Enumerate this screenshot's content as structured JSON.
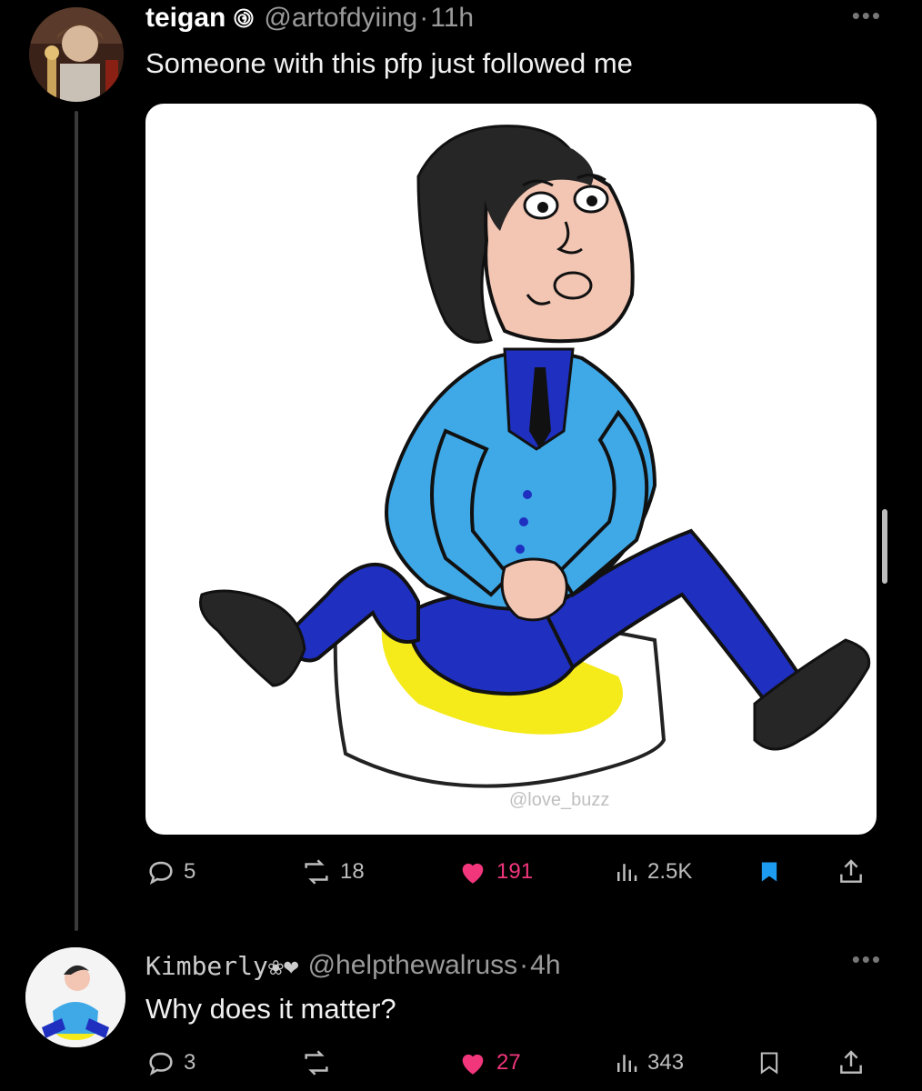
{
  "tweet": {
    "display_name": "teigan",
    "handle": "@artofdyiing",
    "separator": "·",
    "time": "11h",
    "text": "Someone with this pfp just followed me",
    "media_watermark": "@love_buzz",
    "stats": {
      "replies": "5",
      "reposts": "18",
      "likes": "191",
      "views": "2.5K"
    },
    "bookmarked": true,
    "liked": true
  },
  "reply": {
    "display_name": "Kimberly❀❤",
    "handle": "@helpthewalruss",
    "separator": "·",
    "time": "4h",
    "text": "Why does it matter?",
    "stats": {
      "replies": "3",
      "reposts": "",
      "likes": "27",
      "views": "343"
    },
    "bookmarked": false,
    "liked": true
  },
  "colors": {
    "background": "#000000",
    "like": "#f2367c",
    "bookmark": "#1d9bf0",
    "muted": "#9a9a9a",
    "jacket": "#3fa9e8",
    "trousers": "#1f2fbf",
    "cushion_stain": "#f5ea1a"
  }
}
